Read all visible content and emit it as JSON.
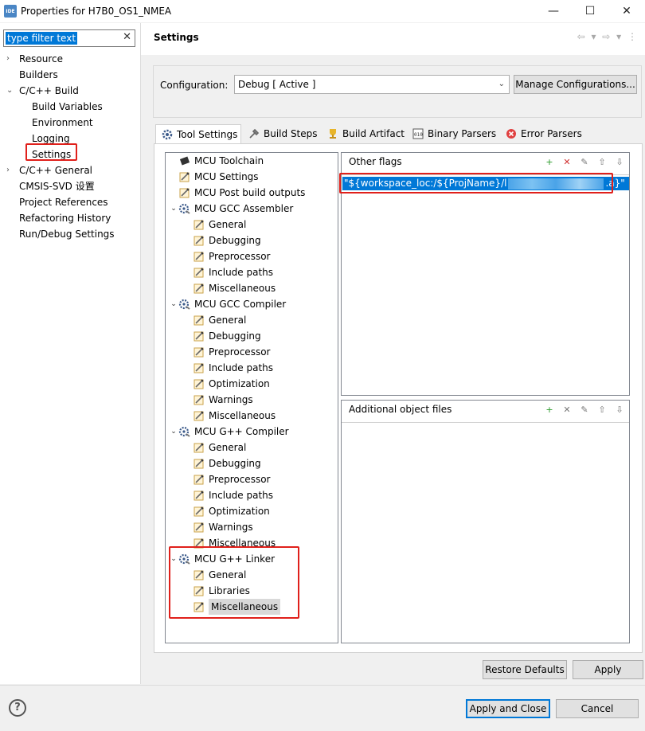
{
  "window": {
    "app_badge": "IDE",
    "title": "Properties for H7B0_OS1_NMEA",
    "minimize": "—",
    "maximize": "☐",
    "close": "✕"
  },
  "filter": {
    "text": "type filter text",
    "clear": "✕"
  },
  "nav": {
    "items": [
      {
        "label": "Resource",
        "arrow": "›"
      },
      {
        "label": "Builders"
      },
      {
        "label": "C/C++ Build",
        "arrow": "⌄"
      },
      {
        "label": "Build Variables"
      },
      {
        "label": "Environment"
      },
      {
        "label": "Logging"
      },
      {
        "label": "Settings"
      },
      {
        "label": "C/C++ General",
        "arrow": "›"
      },
      {
        "label": "CMSIS-SVD 设置"
      },
      {
        "label": "Project References"
      },
      {
        "label": "Refactoring History"
      },
      {
        "label": "Run/Debug Settings"
      }
    ]
  },
  "header": {
    "title": "Settings",
    "nav_glyphs": "⇦ ▾ ⇨ ▾ ⋮"
  },
  "config": {
    "label": "Configuration:",
    "value": "Debug  [ Active ]",
    "caret": "⌄",
    "manage_button": "Manage Configurations..."
  },
  "tabs": [
    {
      "label": "Tool Settings",
      "icon": "gear-icon"
    },
    {
      "label": "Build Steps",
      "icon": "build-steps-icon"
    },
    {
      "label": "Build Artifact",
      "icon": "trophy-icon"
    },
    {
      "label": "Binary Parsers",
      "icon": "binary-icon"
    },
    {
      "label": "Error Parsers",
      "icon": "error-icon"
    }
  ],
  "tree": [
    {
      "label": "MCU Toolchain",
      "level": 0,
      "icon": "chip"
    },
    {
      "label": "MCU Settings",
      "level": 0,
      "icon": "option"
    },
    {
      "label": "MCU Post build outputs",
      "level": 0,
      "icon": "option"
    },
    {
      "label": "MCU GCC Assembler",
      "level": 0,
      "icon": "tool",
      "expanded": true
    },
    {
      "label": "General",
      "level": 1,
      "icon": "option"
    },
    {
      "label": "Debugging",
      "level": 1,
      "icon": "option"
    },
    {
      "label": "Preprocessor",
      "level": 1,
      "icon": "option"
    },
    {
      "label": "Include paths",
      "level": 1,
      "icon": "option"
    },
    {
      "label": "Miscellaneous",
      "level": 1,
      "icon": "option"
    },
    {
      "label": "MCU GCC Compiler",
      "level": 0,
      "icon": "tool",
      "expanded": true
    },
    {
      "label": "General",
      "level": 1,
      "icon": "option"
    },
    {
      "label": "Debugging",
      "level": 1,
      "icon": "option"
    },
    {
      "label": "Preprocessor",
      "level": 1,
      "icon": "option"
    },
    {
      "label": "Include paths",
      "level": 1,
      "icon": "option"
    },
    {
      "label": "Optimization",
      "level": 1,
      "icon": "option"
    },
    {
      "label": "Warnings",
      "level": 1,
      "icon": "option"
    },
    {
      "label": "Miscellaneous",
      "level": 1,
      "icon": "option"
    },
    {
      "label": "MCU G++ Compiler",
      "level": 0,
      "icon": "tool",
      "expanded": true
    },
    {
      "label": "General",
      "level": 1,
      "icon": "option"
    },
    {
      "label": "Debugging",
      "level": 1,
      "icon": "option"
    },
    {
      "label": "Preprocessor",
      "level": 1,
      "icon": "option"
    },
    {
      "label": "Include paths",
      "level": 1,
      "icon": "option"
    },
    {
      "label": "Optimization",
      "level": 1,
      "icon": "option"
    },
    {
      "label": "Warnings",
      "level": 1,
      "icon": "option"
    },
    {
      "label": "Miscellaneous",
      "level": 1,
      "icon": "option"
    },
    {
      "label": "MCU G++ Linker",
      "level": 0,
      "icon": "tool",
      "expanded": true
    },
    {
      "label": "General",
      "level": 1,
      "icon": "option"
    },
    {
      "label": "Libraries",
      "level": 1,
      "icon": "option"
    },
    {
      "label": "Miscellaneous",
      "level": 1,
      "icon": "option",
      "selected": true
    }
  ],
  "other_flags": {
    "title": "Other flags",
    "item_prefix": "\"${workspace_loc:/${ProjName}/l",
    "item_suffix": ".a}\""
  },
  "additional_objects": {
    "title": "Additional object files"
  },
  "tool_glyphs": {
    "add": "+",
    "delete": "✕",
    "edit": "✎",
    "up": "⇧",
    "down": "⇩"
  },
  "buttons": {
    "restore_defaults": "Restore Defaults",
    "apply": "Apply",
    "apply_and_close": "Apply and Close",
    "cancel": "Cancel",
    "help": "?"
  }
}
